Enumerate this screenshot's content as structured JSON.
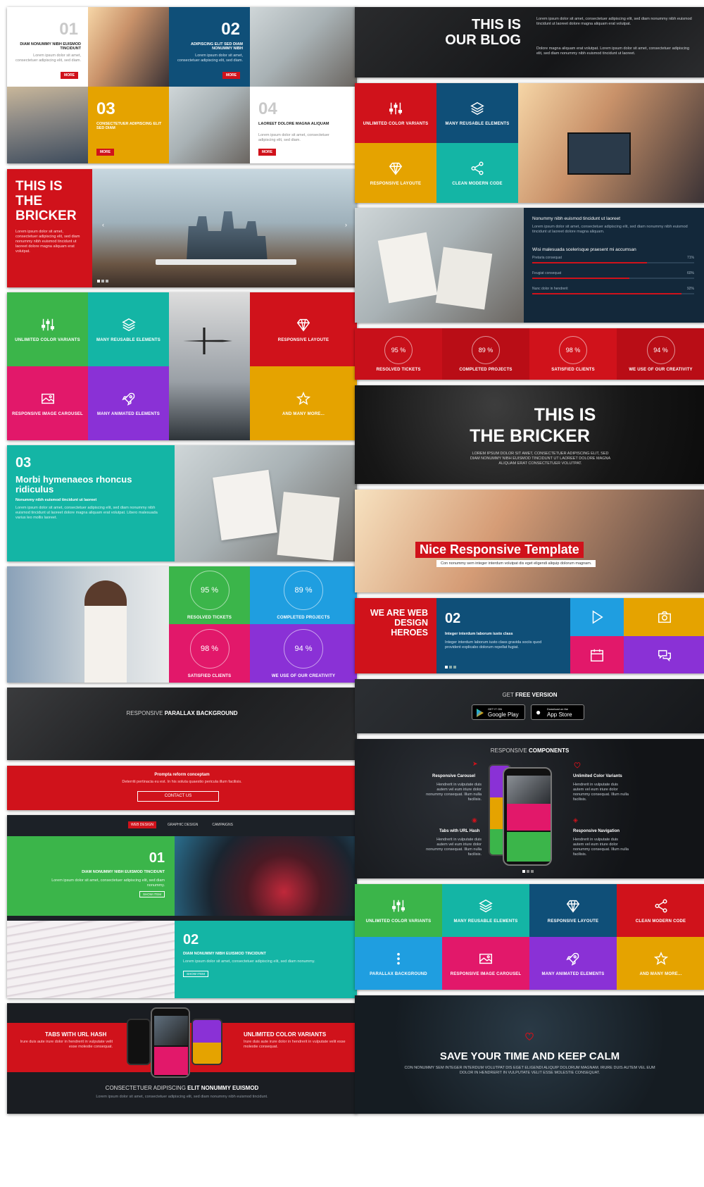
{
  "grid1": [
    {
      "num": "01",
      "title": "DIAM NONUMMY NIBH EUISMOD TINCIDUNT",
      "text": "Lorem ipsum dolor sit amet, consectetuer adipiscing elit, sed diam.",
      "btn": "MORE"
    },
    {
      "num": "02",
      "title": "ADIPISCING ELIT SED DIAM NONUMMY NIBH",
      "text": "Lorem ipsum dolor sit amet, consectetuer adipiscing elit, sed diam.",
      "btn": "MORE"
    },
    {
      "num": "03",
      "title": "CONSECTETUER ADIPISCING ELIT SED DIAM",
      "text": "",
      "btn": "MORE"
    },
    {
      "num": "04",
      "title": "LAOREET DOLORE MAGNA ALIQUAM",
      "text": "Lorem ipsum dolor sit amet, consectetuer adipiscing elit, sed diam.",
      "btn": "MORE"
    }
  ],
  "bricker": {
    "title": "THIS IS THE BRICKER",
    "text": "Lorem ipsum dolor sit amet, consectetuer adipiscing elit, sed diam nonummy nibh euismod tincidunt ut laoreet dolore magna aliquam erat volutpat."
  },
  "features1": [
    {
      "label": "UNLIMITED COLOR VARIANTS",
      "icon": "sliders-icon"
    },
    {
      "label": "MANY REUSABLE ELEMENTS",
      "icon": "layers-icon"
    },
    {
      "label": "RESPONSIVE LAYOUTE",
      "icon": "diamond-icon"
    },
    {
      "label": "RESPONSIVE IMAGE CAROUSEL",
      "icon": "image-icon"
    },
    {
      "label": "MANY ANIMATED ELEMENTS",
      "icon": "rocket-icon"
    },
    {
      "label": "AND MANY MORE...",
      "icon": "star-icon"
    }
  ],
  "article": {
    "num": "03",
    "title": "Morbi hymenaeos rhoncus ridiculus",
    "subtitle": "Nonummy nibh euismod tincidunt ut laoreet",
    "text": "Lorem ipsum dolor sit amet, consectetuer adipiscing elit, sed diam nonummy nibh euismod tincidunt ut laoreet dolore magna aliquam erat volutpat. Libero malesuada varius leo mollis laoreet."
  },
  "stats1": [
    {
      "value": "95 %",
      "label": "RESOLVED TICKETS"
    },
    {
      "value": "89 %",
      "label": "COMPLETED PROJECTS"
    },
    {
      "value": "98 %",
      "label": "SATISFIED CLIENTS"
    },
    {
      "value": "94 %",
      "label": "WE USE OF OUR CREATIVITY"
    }
  ],
  "parallax": {
    "prefix": "RESPONSIVE ",
    "strong": "PARALLAX BACKGROUND"
  },
  "cta": {
    "title": "Prompta reform conceptam",
    "text": "Deterriti pertinacia eu est. In his soluta quaestio pericula illum facilisis.",
    "btn": "CONTACT US"
  },
  "tabs": {
    "items": [
      "WEB DESIGN",
      "GRAPHIC DESIGN",
      "CAMPAIGNS"
    ],
    "rows": [
      {
        "num": "01",
        "title": "DIAM NONUMMY NIBH EUISMOD TINCIDUNT",
        "text": "Lorem ipsum dolor sit amet, consectetuer adipiscing elit, sed diam nonummy.",
        "btn": "SHOW ITEM"
      },
      {
        "num": "02",
        "title": "DIAM NONUMMY NIBH EUISMOD TINCIDUNT",
        "text": "Lorem ipsum dolor sit amet, consectetuer adipiscing elit, sed diam nonummy.",
        "btn": "SHOW ITEM"
      }
    ]
  },
  "phones": {
    "left": "TABS WITH URL HASH",
    "right": "UNLIMITED COLOR VARIANTS",
    "text": "Irure duis aute irure dolor in hendrerit in vulputate velit esse molestie consequat.",
    "bottom_prefix": "CONSECTETUER ADIPISCING ",
    "bottom_strong": "ELIT NONUMMY EUISMOD",
    "bottom_text": "Lorem ipsum dolor sit amet, consectetuer adipiscing elit, sed diam nonummy nibh euismod tincidunt."
  },
  "blog": {
    "title": "THIS IS OUR BLOG",
    "text1": "Lorem ipsum dolor sit amet, consectetuer adipiscing elit, sed diam nonummy nibh euismod tincidunt ut laoreet dolore magna aliquam erat volutpat.",
    "text2": "Dolore magna aliquam erat volutpat. Lorem ipsum dolor sit amet, consectetuer adipiscing elit, sed diam nonummy nibh euismod tincidunt ut laoreet."
  },
  "features2": [
    {
      "label": "UNLIMITED COLOR VARIANTS"
    },
    {
      "label": "MANY REUSABLE ELEMENTS"
    },
    {
      "label": "RESPONSIVE LAYOUTE"
    },
    {
      "label": "CLEAN MODERN CODE"
    }
  ],
  "skills": {
    "heading": "Nonummy nibh euismod tincidunt ut laoreet",
    "text": "Lorem ipsum dolor sit amet, consectetuer adipiscing elit, sed diam nonummy nibh euismod tincidunt ut laoreet dolore magna aliquam.",
    "sub": "Wisi malesuada scelerisque praesent mi accumsan",
    "bars": [
      {
        "label": "Pretaria consequat",
        "value": "71%",
        "fill": 0.71
      },
      {
        "label": "Feugiat consequat",
        "value": "60%",
        "fill": 0.6
      },
      {
        "label": "Nunc dolor in hendrerit",
        "value": "92%",
        "fill": 0.92
      }
    ]
  },
  "stats2": [
    {
      "value": "95 %",
      "label": "RESOLVED TICKETS"
    },
    {
      "value": "89 %",
      "label": "COMPLETED PROJECTS"
    },
    {
      "value": "98 %",
      "label": "SATISFIED CLIENTS"
    },
    {
      "value": "94 %",
      "label": "WE USE OF OUR CREATIVITY"
    }
  ],
  "hero": {
    "title1": "THIS IS",
    "title2": "THE BRICKER",
    "text": "LOREM IPSUM DOLOR SIT AMET, CONSECTETUER ADIPISCING ELIT, SED DIAM NONUMMY NIBH EUISMOD TINCIDUNT UT LAOREET DOLORE MAGNA ALIQUAM ERAT CONSECTETUER VOLUTPAT."
  },
  "nice": {
    "title": "Nice Responsive Template",
    "text": "Con nonummy sem integer interdum volutpat dis eget eligendi aliquip dolorum magnam."
  },
  "heroes": {
    "title": "WE ARE WEB DESIGN HEROES",
    "num": "02",
    "subtitle": "Integer interdum laborum iusto class",
    "text": "Integer interdum laborum iusto class gravida sociis quod provident explicabo dolorum repellat fugiat."
  },
  "app": {
    "prefix": "GET ",
    "strong": "FREE VERSION",
    "gp_small": "GET IT ON",
    "gp": "Google Play",
    "as_small": "Download on the",
    "as": "App Store"
  },
  "components": {
    "prefix": "RESPONSIVE ",
    "strong": "COMPONENTS",
    "items": [
      {
        "title": "Responsive Carousel",
        "text": "Hendrerit in vulputate duis autem vel eum iriure dolor nonummy consequat. Illum nulla facilisis."
      },
      {
        "title": "Unlimited Color Variants",
        "text": "Hendrerit in vulputate duis autem vel eum iriure dolor nonummy consequat. Illum nulla facilisis."
      },
      {
        "title": "Tabs with URL Hash",
        "text": "Hendrerit in vulputate duis autem vel eum iriure dolor nonummy consequat. Illum nulla facilisis."
      },
      {
        "title": "Responsive Navigation",
        "text": "Hendrerit in vulputate duis autem vel eum iriure dolor nonummy consequat. Illum nulla facilisis."
      }
    ]
  },
  "features3": [
    {
      "label": "UNLIMITED COLOR VARIANTS"
    },
    {
      "label": "MANY REUSABLE ELEMENTS"
    },
    {
      "label": "RESPONSIVE LAYOUTE"
    },
    {
      "label": "CLEAN MODERN CODE"
    },
    {
      "label": "PARALLAX BACKGROUND"
    },
    {
      "label": "RESPONSIVE IMAGE CAROUSEL"
    },
    {
      "label": "MANY ANIMATED ELEMENTS"
    },
    {
      "label": "AND MANY MORE..."
    }
  ],
  "calm": {
    "title": "SAVE YOUR TIME AND KEEP CALM",
    "text": "CON NONUMMY SEM INTEGER INTERDUM VOLUTPAT DIS EGET ELIGENDI ALIQUIP DOLORUM MAGNAM. IRURE DUIS AUTEM VEL EUM DOLOR IN HENDRERIT IN VULPUTATE VELIT ESSE MOLESTIE CONSEQUAT."
  },
  "colors": {
    "red": "#d0121b",
    "green": "#3bb54a",
    "teal": "#14b5a5",
    "blue": "#0f4f78",
    "yellow": "#e5a300",
    "pink": "#e2186a",
    "purple": "#8a31d6",
    "sky": "#1f9ee0"
  }
}
